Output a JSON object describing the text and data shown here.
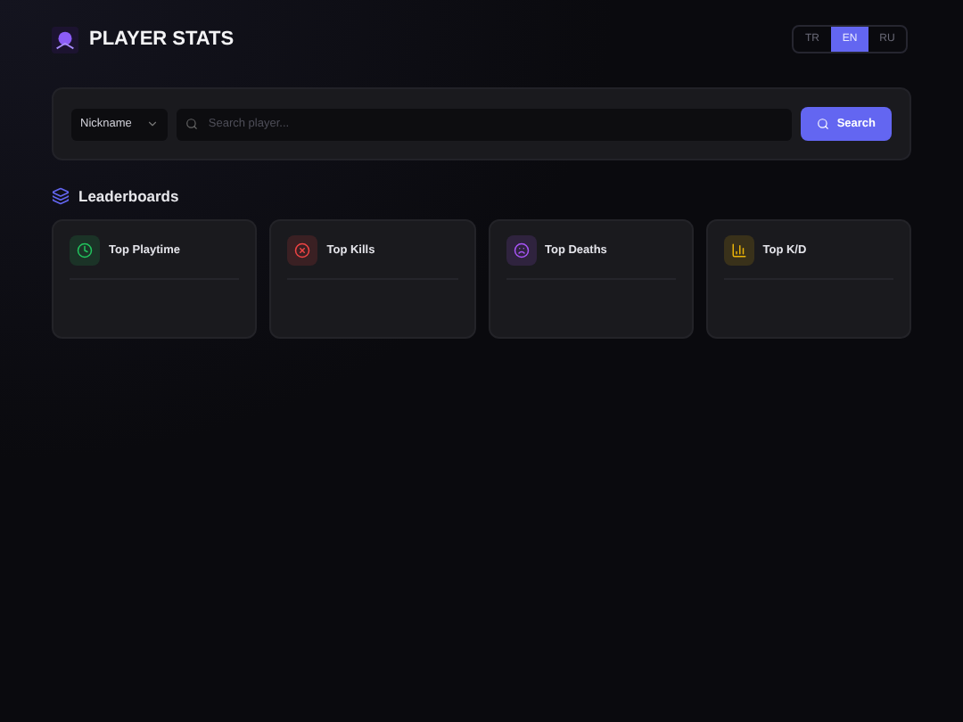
{
  "header": {
    "title": "PLAYER STATS",
    "languages": [
      {
        "label": "TR",
        "selected": false
      },
      {
        "label": "EN",
        "selected": true
      },
      {
        "label": "RU",
        "selected": false
      }
    ]
  },
  "search": {
    "filter": "Nickname",
    "placeholder": "Search player...",
    "button": "Search"
  },
  "section": {
    "title": "Leaderboards"
  },
  "leaderboards": [
    {
      "title": "Top Playtime",
      "kind": "clock",
      "color": "#22c55e"
    },
    {
      "title": "Top Kills",
      "kind": "target",
      "color": "#ef4444"
    },
    {
      "title": "Top Deaths",
      "kind": "face",
      "color": "#a855f7"
    },
    {
      "title": "Top K/D",
      "kind": "bars",
      "color": "#eab308"
    }
  ]
}
